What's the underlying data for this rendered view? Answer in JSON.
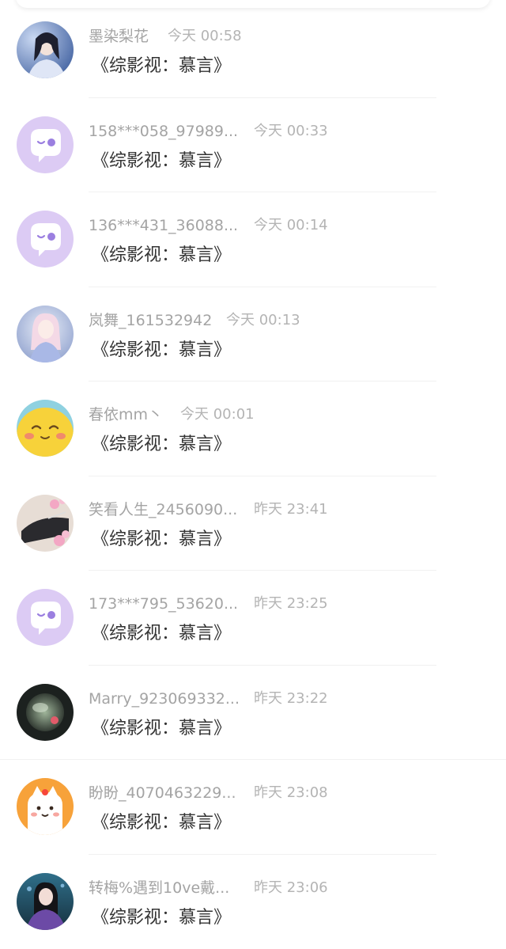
{
  "rows": [
    {
      "name": "墨染梨花",
      "time": "今天 00:58",
      "book": "《综影视：慕言》",
      "avatar": "photo-woman-blue-icon"
    },
    {
      "name": "158***058_97989...",
      "time": "今天 00:33",
      "book": "《综影视：慕言》",
      "avatar": "default-chat-icon"
    },
    {
      "name": "136***431_36088...",
      "time": "今天 00:14",
      "book": "《综影视：慕言》",
      "avatar": "default-chat-icon"
    },
    {
      "name": "岚舞_161532942",
      "time": "今天 00:13",
      "book": "《综影视：慕言》",
      "avatar": "photo-doll-icon"
    },
    {
      "name": "春依mm丶",
      "time": "今天 00:01",
      "book": "《综影视：慕言》",
      "avatar": "yellow-cartoon-icon"
    },
    {
      "name": "笑看人生_2456090...",
      "time": "昨天 23:41",
      "book": "《综影视：慕言》",
      "avatar": "photo-flowers-icon"
    },
    {
      "name": "173***795_53620...",
      "time": "昨天 23:25",
      "book": "《综影视：慕言》",
      "avatar": "default-chat-icon"
    },
    {
      "name": "Marry_923069332...",
      "time": "昨天 23:22",
      "book": "《综影视：慕言》",
      "avatar": "photo-bubble-icon"
    },
    {
      "name": "盼盼_4070463229...",
      "time": "昨天 23:08",
      "book": "《综影视：慕言》",
      "avatar": "orange-cartoon-dog-icon"
    },
    {
      "name": "转梅%遇到10ve戴...",
      "time": "昨天 23:06",
      "book": "《综影视：慕言》",
      "avatar": "photo-costume-icon"
    }
  ],
  "colors": {
    "name_text": "#a4a4a4",
    "time_text": "#b4b4b4",
    "book_text": "#333333",
    "default_avatar_bg": "#dccbf4",
    "default_avatar_accent": "#9b7fe0"
  }
}
